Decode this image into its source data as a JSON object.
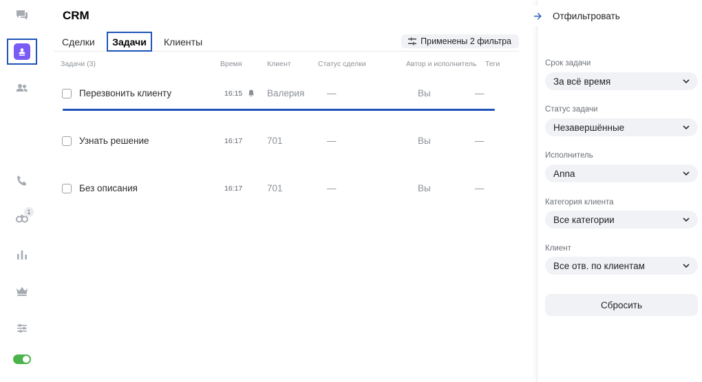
{
  "app": {
    "title": "CRM"
  },
  "rail": {
    "items": [
      {
        "icon": "chat-icon"
      },
      {
        "icon": "crm-icon",
        "active": true
      },
      {
        "icon": "contacts-icon"
      },
      {
        "icon": "phone-icon"
      },
      {
        "icon": "bots-icon",
        "badge": "1"
      },
      {
        "icon": "stats-icon"
      },
      {
        "icon": "crown-icon"
      },
      {
        "icon": "settings-sliders-icon"
      },
      {
        "icon": "toggle-on"
      }
    ],
    "toggle_color": "#4bb34b",
    "active_chip_color": "#7a5cf5"
  },
  "tabs": [
    {
      "label": "Сделки",
      "active": false
    },
    {
      "label": "Задачи",
      "active": true
    },
    {
      "label": "Клиенты",
      "active": false
    }
  ],
  "filters_applied_label": "Применены 2 фильтра",
  "columns": {
    "tasks": "Задачи (3)",
    "time": "Время",
    "client": "Клиент",
    "deal_status": "Статус сделки",
    "author": "Автор и исполнитель",
    "tags": "Теги"
  },
  "rows": [
    {
      "title": "Перезвонить клиенту",
      "time": "16:15",
      "reminder": true,
      "client": "Валерия",
      "deal_status": "—",
      "author": "Вы",
      "tags": "—"
    },
    {
      "title": "Узнать решение",
      "time": "16:17",
      "reminder": false,
      "client": "701",
      "deal_status": "—",
      "author": "Вы",
      "tags": "—"
    },
    {
      "title": "Без описания",
      "time": "16:17",
      "reminder": false,
      "client": "701",
      "deal_status": "—",
      "author": "Вы",
      "tags": "—"
    }
  ],
  "panel": {
    "header": "Отфильтровать",
    "filters": [
      {
        "label": "Срок задачи",
        "value": "За всё время"
      },
      {
        "label": "Статус задачи",
        "value": "Незавершённые"
      },
      {
        "label": "Исполнитель",
        "value": "Anna"
      },
      {
        "label": "Категория клиента",
        "value": "Все категории"
      },
      {
        "label": "Клиент",
        "value": "Все отв. по клиентам"
      }
    ],
    "reset_label": "Сбросить"
  },
  "colors": {
    "accent": "#1d52b8",
    "link": "#2a5db8"
  }
}
